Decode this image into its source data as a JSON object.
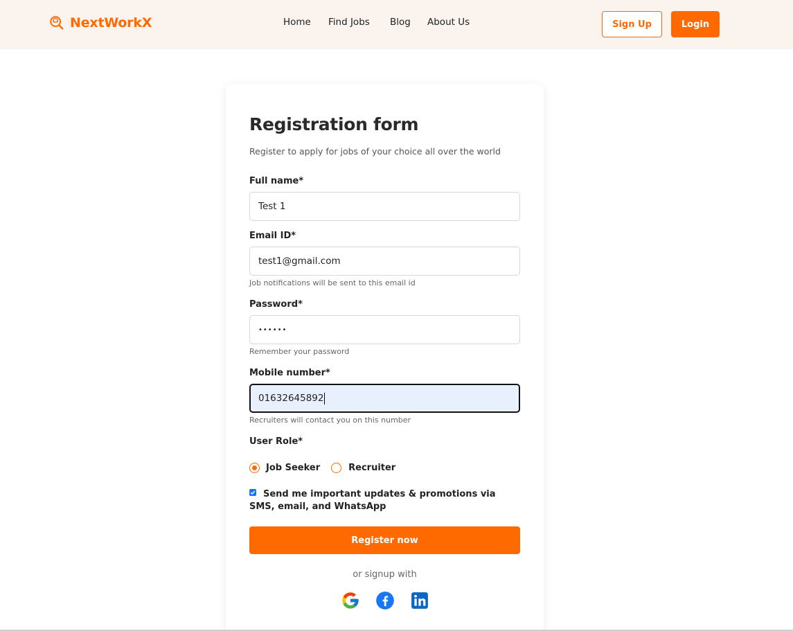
{
  "header": {
    "brand": "NextWorkX",
    "nav": [
      "Home",
      "Find Jobs",
      "Blog",
      "About Us"
    ],
    "signup_label": "Sign Up",
    "login_label": "Login"
  },
  "form": {
    "title": "Registration form",
    "subtitle": "Register to apply for jobs of your choice all over the world",
    "fields": {
      "full_name": {
        "label": "Full name*",
        "value": "Test 1"
      },
      "email": {
        "label": "Email ID*",
        "value": "test1@gmail.com",
        "hint": "Job notifications will be sent to this email id"
      },
      "password": {
        "label": "Password*",
        "value": "••••••",
        "hint": "Remember your password"
      },
      "mobile": {
        "label": "Mobile number*",
        "value": "01632645892",
        "hint": "Recruiters will contact you on this number"
      }
    },
    "user_role": {
      "label": "User Role*",
      "options": [
        "Job Seeker",
        "Recruiter"
      ],
      "selected": "Job Seeker"
    },
    "consent": {
      "checked": true,
      "text": "Send me important updates & promotions via SMS, email, and WhatsApp"
    },
    "submit_label": "Register now",
    "social_prompt": "or signup with",
    "social_icons": [
      "google-icon",
      "facebook-icon",
      "linkedin-icon"
    ]
  },
  "colors": {
    "accent": "#ff6a00",
    "header_bg": "#faf3ee",
    "focus_bg": "#e8f0fe",
    "checkbox": "#1a73e8"
  }
}
